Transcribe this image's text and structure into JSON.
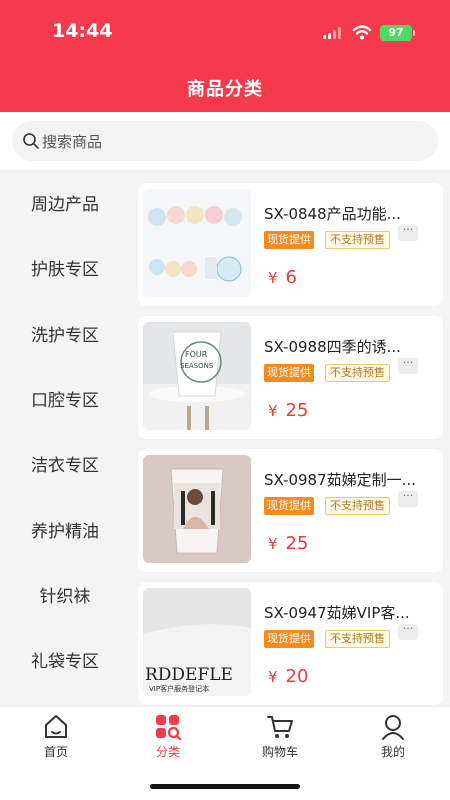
{
  "status": {
    "time": "14:44",
    "battery": "97"
  },
  "header": {
    "title": "商品分类"
  },
  "search": {
    "placeholder": "搜索商品"
  },
  "sidebar": {
    "items": [
      {
        "label": "周边产品"
      },
      {
        "label": "护肤专区"
      },
      {
        "label": "洗护专区"
      },
      {
        "label": "口腔专区"
      },
      {
        "label": "洁衣专区"
      },
      {
        "label": "养护精油"
      },
      {
        "label": "针织袜"
      },
      {
        "label": "礼袋专区"
      }
    ]
  },
  "products": [
    {
      "name": "SX-0848产品功能...",
      "tag1": "现货提供",
      "tag2": "不支持预售",
      "currency": "¥",
      "price": "6"
    },
    {
      "name": "SX-0988四季的诱...",
      "tag1": "现货提供",
      "tag2": "不支持预售",
      "currency": "¥",
      "price": "25",
      "image_text": [
        "FOUR",
        "SEASONS"
      ]
    },
    {
      "name": "SX-0987茹娣定制一...",
      "tag1": "现货提供",
      "tag2": "不支持预售",
      "currency": "¥",
      "price": "25"
    },
    {
      "name": "SX-0947茹娣VIP客...",
      "tag1": "现货提供",
      "tag2": "不支持预售",
      "currency": "¥",
      "price": "20",
      "image_text": [
        "RDDEFLE",
        "VIP客户服务登记本"
      ]
    }
  ],
  "tabbar": {
    "home": "首页",
    "category": "分类",
    "cart": "购物车",
    "mine": "我的"
  },
  "colors": {
    "brand": "#f43a4b",
    "price": "#e33e3e",
    "tag_orange": "#f58a1f"
  }
}
